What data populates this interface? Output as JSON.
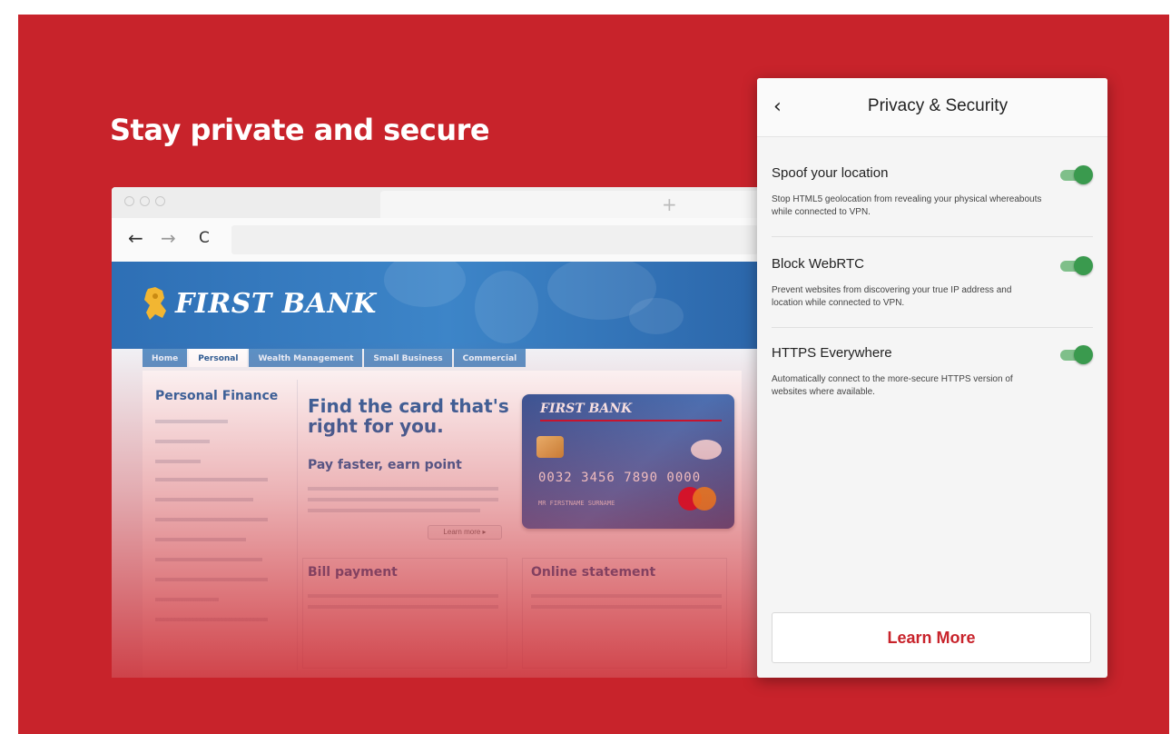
{
  "headline": "Stay private and secure",
  "browser": {
    "new_tab_glyph": "+",
    "back_icon": "←",
    "forward_icon": "→",
    "reload_icon": "C"
  },
  "site": {
    "brand": "FIRST BANK",
    "nav": [
      "Home",
      "Personal",
      "Wealth Management",
      "Small Business",
      "Commercial"
    ],
    "active_nav": "Personal",
    "sidebar_title": "Personal Finance",
    "promo_title": "Find the card that's right for you.",
    "promo_sub": "Pay faster, earn point",
    "learn_more_mini": "Learn more ▸",
    "card": {
      "brand": "FIRST BANK",
      "number": "0032 3456 7890 0000",
      "holder": "MR FIRSTNAME SURNAME"
    },
    "box1_title": "Bill payment",
    "box2_title": "Online statement"
  },
  "panel": {
    "back_icon": "‹",
    "title": "Privacy & Security",
    "settings": [
      {
        "title": "Spoof your location",
        "desc": "Stop HTML5 geolocation from revealing your physical whereabouts while connected to VPN.",
        "enabled": true
      },
      {
        "title": "Block WebRTC",
        "desc": "Prevent websites from discovering your true IP address and location while connected to VPN.",
        "enabled": true
      },
      {
        "title": "HTTPS Everywhere",
        "desc": "Automatically connect to the more-secure HTTPS version of websites where available.",
        "enabled": true
      }
    ],
    "learn_more": "Learn More"
  },
  "colors": {
    "brand_red": "#c8232b",
    "toggle_on": "#3a9a4e",
    "bank_blue": "#2a68a6"
  }
}
